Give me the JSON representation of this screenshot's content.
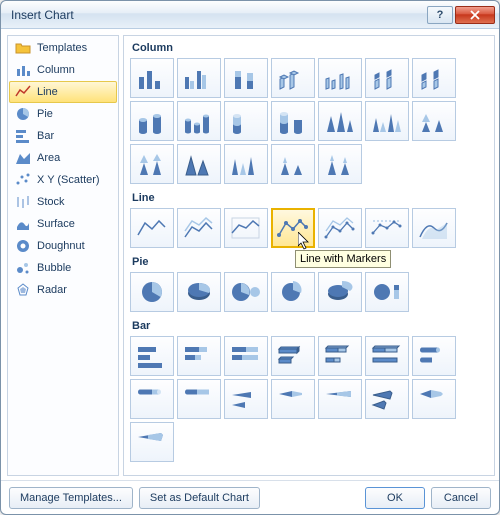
{
  "title": "Insert Chart",
  "sidebar": {
    "items": [
      {
        "label": "Templates"
      },
      {
        "label": "Column"
      },
      {
        "label": "Line"
      },
      {
        "label": "Pie"
      },
      {
        "label": "Bar"
      },
      {
        "label": "Area"
      },
      {
        "label": "X Y (Scatter)"
      },
      {
        "label": "Stock"
      },
      {
        "label": "Surface"
      },
      {
        "label": "Doughnut"
      },
      {
        "label": "Bubble"
      },
      {
        "label": "Radar"
      }
    ]
  },
  "sections": {
    "column": "Column",
    "line": "Line",
    "pie": "Pie",
    "bar": "Bar"
  },
  "tooltip": "Line with Markers",
  "footer": {
    "manage": "Manage Templates...",
    "setDefault": "Set as Default Chart",
    "ok": "OK",
    "cancel": "Cancel"
  }
}
